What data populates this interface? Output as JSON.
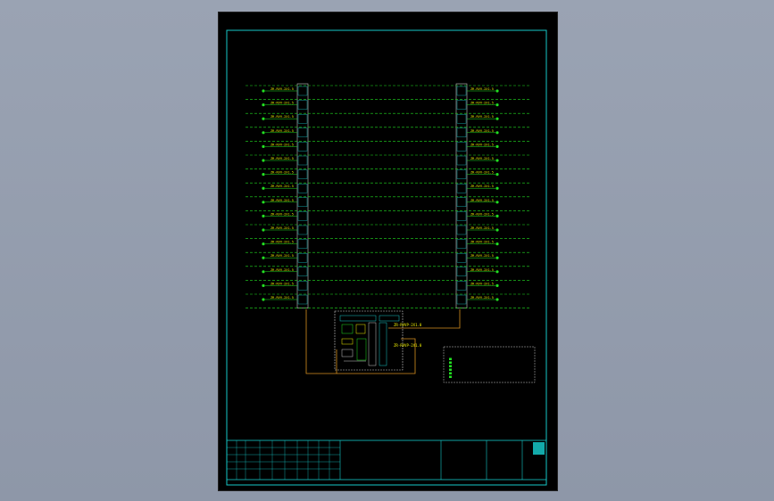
{
  "colors": {
    "background": "#8e97a8",
    "sheet": "#000000",
    "frame": "#16c8c8",
    "wire_green": "#22e022",
    "bus": "#c8c8c8",
    "label_yellow": "#f0f000",
    "cable_orange": "#d89020",
    "note_red": "#e03030"
  },
  "left_panel": {
    "header": "",
    "cable_label": "ZR-RVV-2X1.5",
    "row_count": 16
  },
  "right_panel": {
    "header": "",
    "cable_label": "ZR-RVV-2X1.5",
    "row_count": 16
  },
  "controller": {
    "line1": "ZR-RVVP-2X1.0",
    "line2": "ZR-RVVP-2X1.0",
    "bottom_label": "",
    "caption": ""
  },
  "legend": {
    "title": "",
    "items": [
      "",
      "",
      "",
      "",
      "",
      ""
    ]
  },
  "title_block": {
    "left_fields": [
      "",
      "",
      "",
      "",
      "",
      ""
    ],
    "right_fields": [
      "",
      "",
      "",
      ""
    ]
  }
}
